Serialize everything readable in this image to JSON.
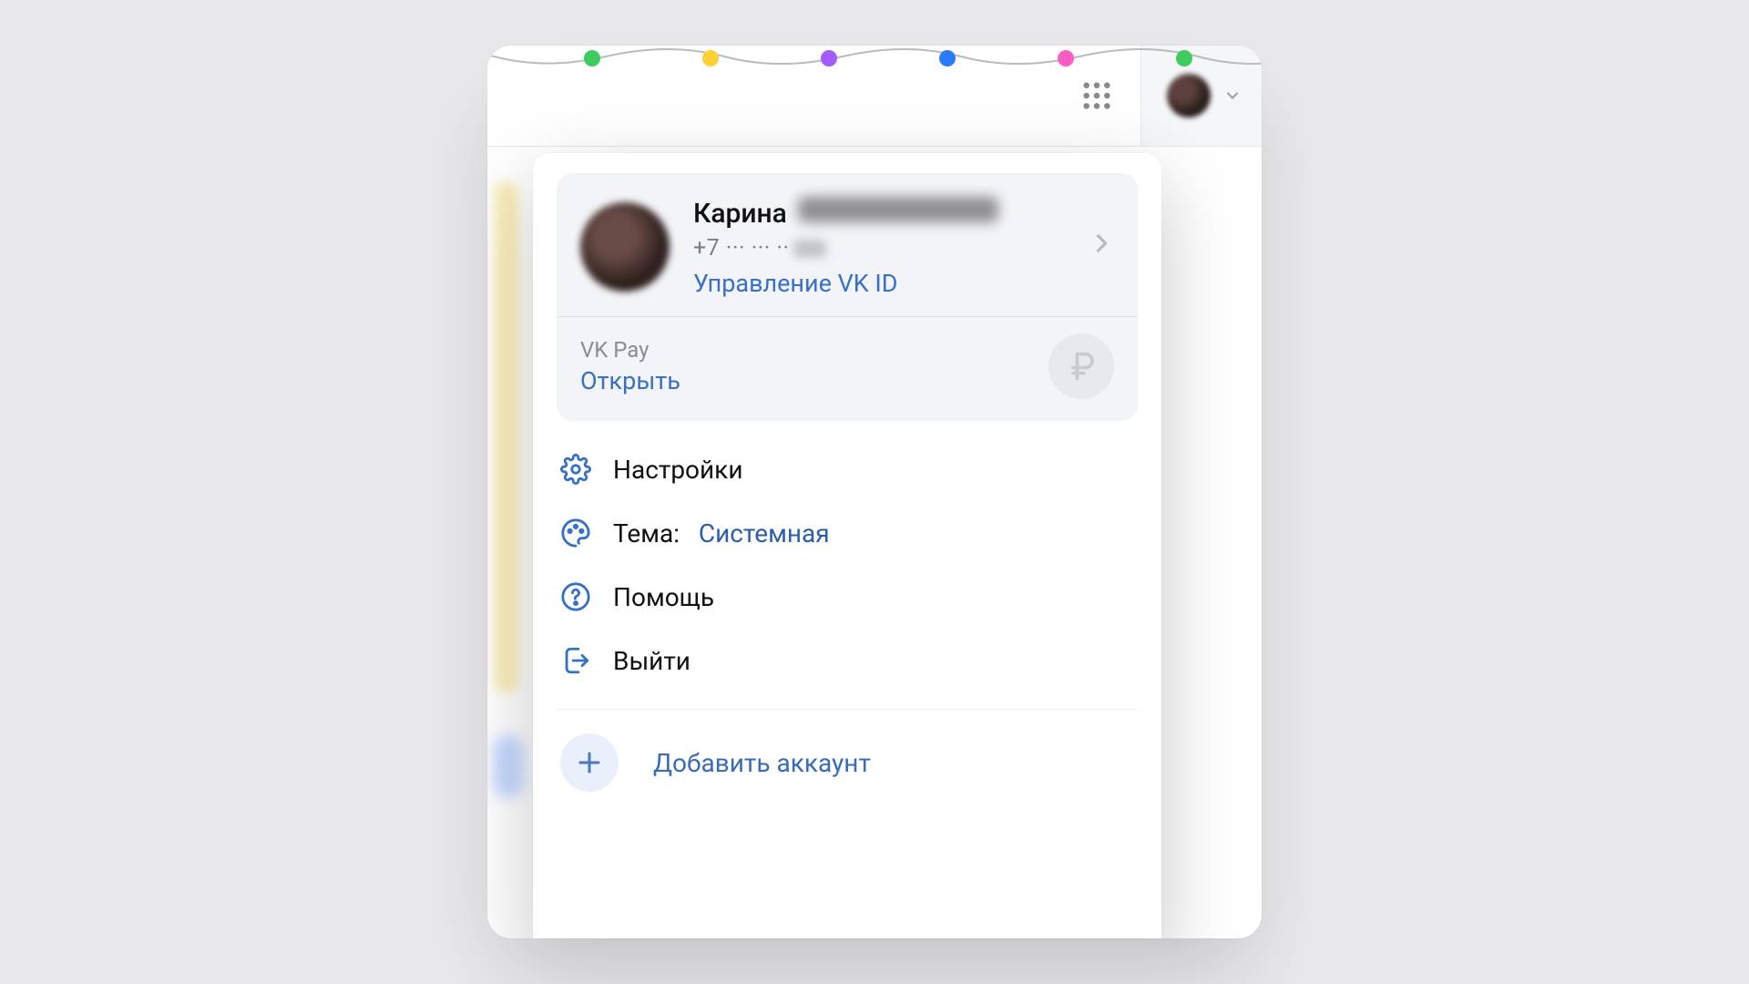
{
  "profile": {
    "first_name": "Карина",
    "phone_masked": "+7 ··· ··· ··",
    "vkid_link": "Управление VK ID"
  },
  "vkpay": {
    "label": "VK Pay",
    "open": "Открыть"
  },
  "menu": {
    "settings": "Настройки",
    "theme_label": "Тема:",
    "theme_value": "Системная",
    "help": "Помощь",
    "logout": "Выйти"
  },
  "add_account": "Добавить аккаунт",
  "colors": {
    "link": "#3770c4"
  }
}
